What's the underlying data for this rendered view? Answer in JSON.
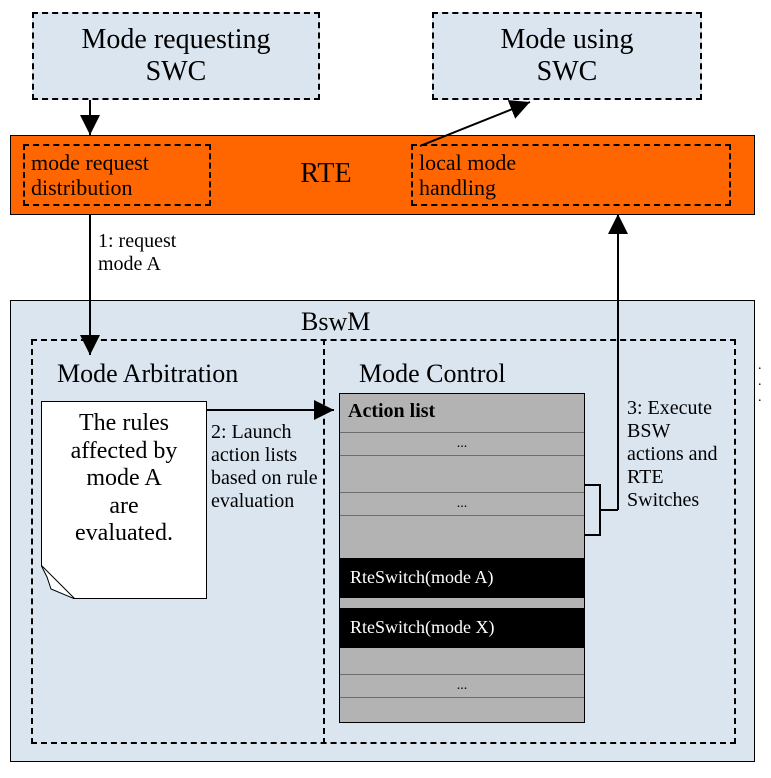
{
  "swc_request": "Mode requesting\nSWC",
  "swc_using": "Mode using\nSWC",
  "rte": {
    "label": "RTE",
    "dist": "mode request\ndistribution",
    "local": "local mode\nhandling"
  },
  "step1": "1: request\nmode A",
  "bswm": {
    "title": "BswM",
    "arb_title": "Mode Arbitration",
    "ctrl_title": "Mode Control",
    "rules_note": "The rules\naffected by\nmode A\nare\nevaluated.",
    "step2": "2: Launch\naction lists\nbased on rule\nevaluation",
    "step3": "3: Execute\nBSW\nactions and\nRTE\nSwitches",
    "action_list": {
      "header": "Action list",
      "rows": [
        "...",
        "...",
        "RteSwitch(mode A)",
        "RteSwitch(mode X)",
        "..."
      ]
    }
  },
  "dots": ". . ."
}
